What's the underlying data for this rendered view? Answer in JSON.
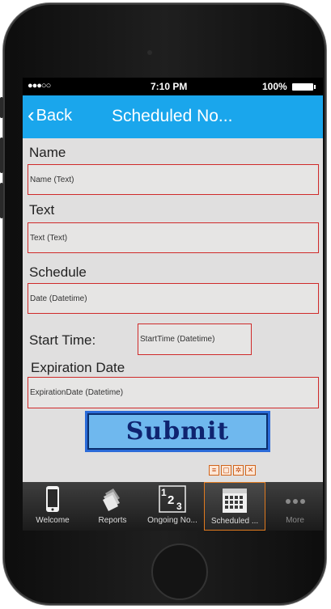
{
  "status_bar": {
    "signal": "●●●○○",
    "time": "7:10 PM",
    "battery": "100%"
  },
  "nav": {
    "back_label": "Back",
    "title": "Scheduled No..."
  },
  "form": {
    "name_label": "Name",
    "name_placeholder": "Name (Text)",
    "text_label": "Text",
    "text_placeholder": "Text (Text)",
    "schedule_label": "Schedule",
    "schedule_placeholder": "Date (Datetime)",
    "start_label": "Start Time:",
    "start_placeholder": "StartTime (Datetime)",
    "expiration_label": "Expiration Date",
    "expiration_placeholder": "ExpirationDate (Datetime)",
    "submit_label": "Submit"
  },
  "tabs": [
    {
      "label": "Welcome",
      "icon": "phone-icon"
    },
    {
      "label": "Reports",
      "icon": "documents-icon"
    },
    {
      "label": "Ongoing No...",
      "icon": "numbers-icon"
    },
    {
      "label": "Scheduled ...",
      "icon": "calendar-icon",
      "active": true
    },
    {
      "label": "More",
      "icon": "more-icon"
    }
  ],
  "colors": {
    "nav": "#1aa6ec",
    "field_border": "#cf2a2a",
    "submit": "#6fb8ee",
    "active_tab": "#e07a1f"
  }
}
